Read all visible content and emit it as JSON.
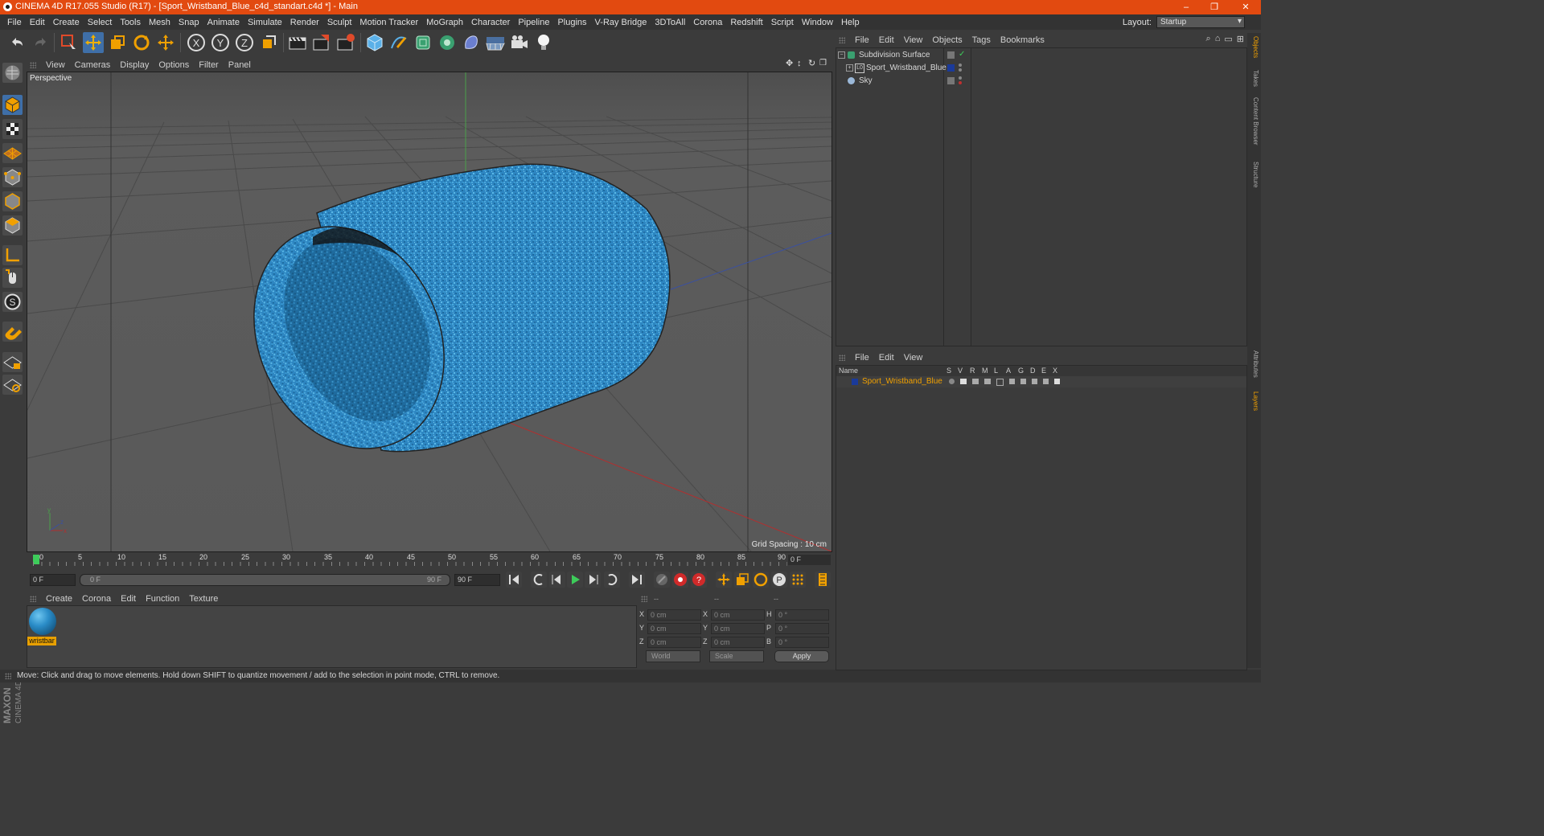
{
  "window": {
    "title": "CINEMA 4D R17.055 Studio (R17) - [Sport_Wristband_Blue_c4d_standart.c4d *] - Main",
    "controls": [
      "–",
      "❐",
      "✕"
    ]
  },
  "menubar": {
    "items": [
      "File",
      "Edit",
      "Create",
      "Select",
      "Tools",
      "Mesh",
      "Snap",
      "Animate",
      "Simulate",
      "Render",
      "Sculpt",
      "Motion Tracker",
      "MoGraph",
      "Character",
      "Pipeline",
      "Plugins",
      "V-Ray Bridge",
      "3DToAll",
      "Corona",
      "Redshift",
      "Script",
      "Window",
      "Help"
    ],
    "layout_label": "Layout:",
    "layout_value": "Startup"
  },
  "toolbar": {
    "axis_labels": [
      "X",
      "Y",
      "Z"
    ]
  },
  "viewport": {
    "menu": [
      "View",
      "Cameras",
      "Display",
      "Options",
      "Filter",
      "Panel"
    ],
    "label": "Perspective",
    "grid_spacing": "Grid Spacing : 10 cm",
    "axis_y": "y",
    "axis_x": "x",
    "axis_z": "z"
  },
  "timeline": {
    "ticks": [
      "0",
      "5",
      "10",
      "15",
      "20",
      "25",
      "30",
      "35",
      "40",
      "45",
      "50",
      "55",
      "60",
      "65",
      "70",
      "75",
      "80",
      "85",
      "90"
    ],
    "current_frame": "0 F",
    "start_field": "0 F",
    "range_start": "0 F",
    "range_end": "90 F",
    "end_field": "90 F"
  },
  "materials": {
    "menu": [
      "Create",
      "Corona",
      "Edit",
      "Function",
      "Texture"
    ],
    "items": [
      {
        "name": "wristbar",
        "color": "#2a8cc7"
      }
    ]
  },
  "coordinates": {
    "header": [
      "--",
      "--",
      "--"
    ],
    "rows": [
      {
        "a": "X",
        "a_val": "0 cm",
        "b": "X",
        "b_val": "0 cm",
        "c": "H",
        "c_val": "0 °"
      },
      {
        "a": "Y",
        "a_val": "0 cm",
        "b": "Y",
        "b_val": "0 cm",
        "c": "P",
        "c_val": "0 °"
      },
      {
        "a": "Z",
        "a_val": "0 cm",
        "b": "Z",
        "b_val": "0 cm",
        "c": "B",
        "c_val": "0 °"
      }
    ],
    "space": "World",
    "mode": "Scale",
    "apply": "Apply"
  },
  "objects": {
    "menu": [
      "File",
      "Edit",
      "View",
      "Objects",
      "Tags",
      "Bookmarks"
    ],
    "items": [
      {
        "name": "Subdivision Surface",
        "icon": "subdivision-icon"
      },
      {
        "name": "Sport_Wristband_Blue",
        "icon": "polygon-object-icon"
      },
      {
        "name": "Sky",
        "icon": "sky-icon"
      }
    ]
  },
  "layers": {
    "menu": [
      "File",
      "Edit",
      "View"
    ],
    "columns": [
      "Name",
      "S",
      "V",
      "R",
      "M",
      "L",
      "A",
      "G",
      "D",
      "E",
      "X"
    ],
    "items": [
      {
        "name": "Sport_Wristband_Blue",
        "color": "#1a3a9a"
      }
    ]
  },
  "right_tabs": [
    "Objects",
    "Takes",
    "Content Browser",
    "Structure",
    "Attributes",
    "Layers"
  ],
  "brand": {
    "maxon": "MAXON",
    "c4d": "CINEMA 4D"
  },
  "status": {
    "text": "Move: Click and drag to move elements. Hold down SHIFT to quantize movement / add to the selection in point mode, CTRL to remove."
  },
  "colors": {
    "titlebar": "#e24a10",
    "accent_orange": "#e8a000",
    "wristband_blue": "#2a8cc7",
    "active_tool": "#3f6fa8"
  }
}
